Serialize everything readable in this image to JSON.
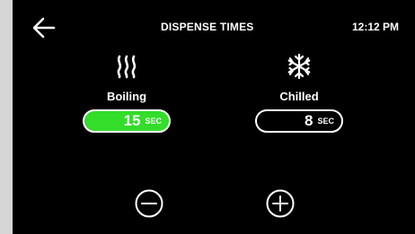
{
  "header": {
    "title": "DISPENSE TIMES",
    "time": "12:12 PM",
    "back_icon": "arrow-left-icon"
  },
  "modes": [
    {
      "label": "Boiling",
      "icon": "steam-icon",
      "value": "15",
      "unit": "SEC",
      "selected": true
    },
    {
      "label": "Chilled",
      "icon": "snowflake-icon",
      "value": "8",
      "unit": "SEC",
      "selected": false
    }
  ],
  "controls": {
    "decrement_icon": "minus-circle-icon",
    "increment_icon": "plus-circle-icon"
  },
  "colors": {
    "background": "#000000",
    "text": "#ffffff",
    "selected_accent": "#33dd2a",
    "frame": "#d5d5d5"
  }
}
